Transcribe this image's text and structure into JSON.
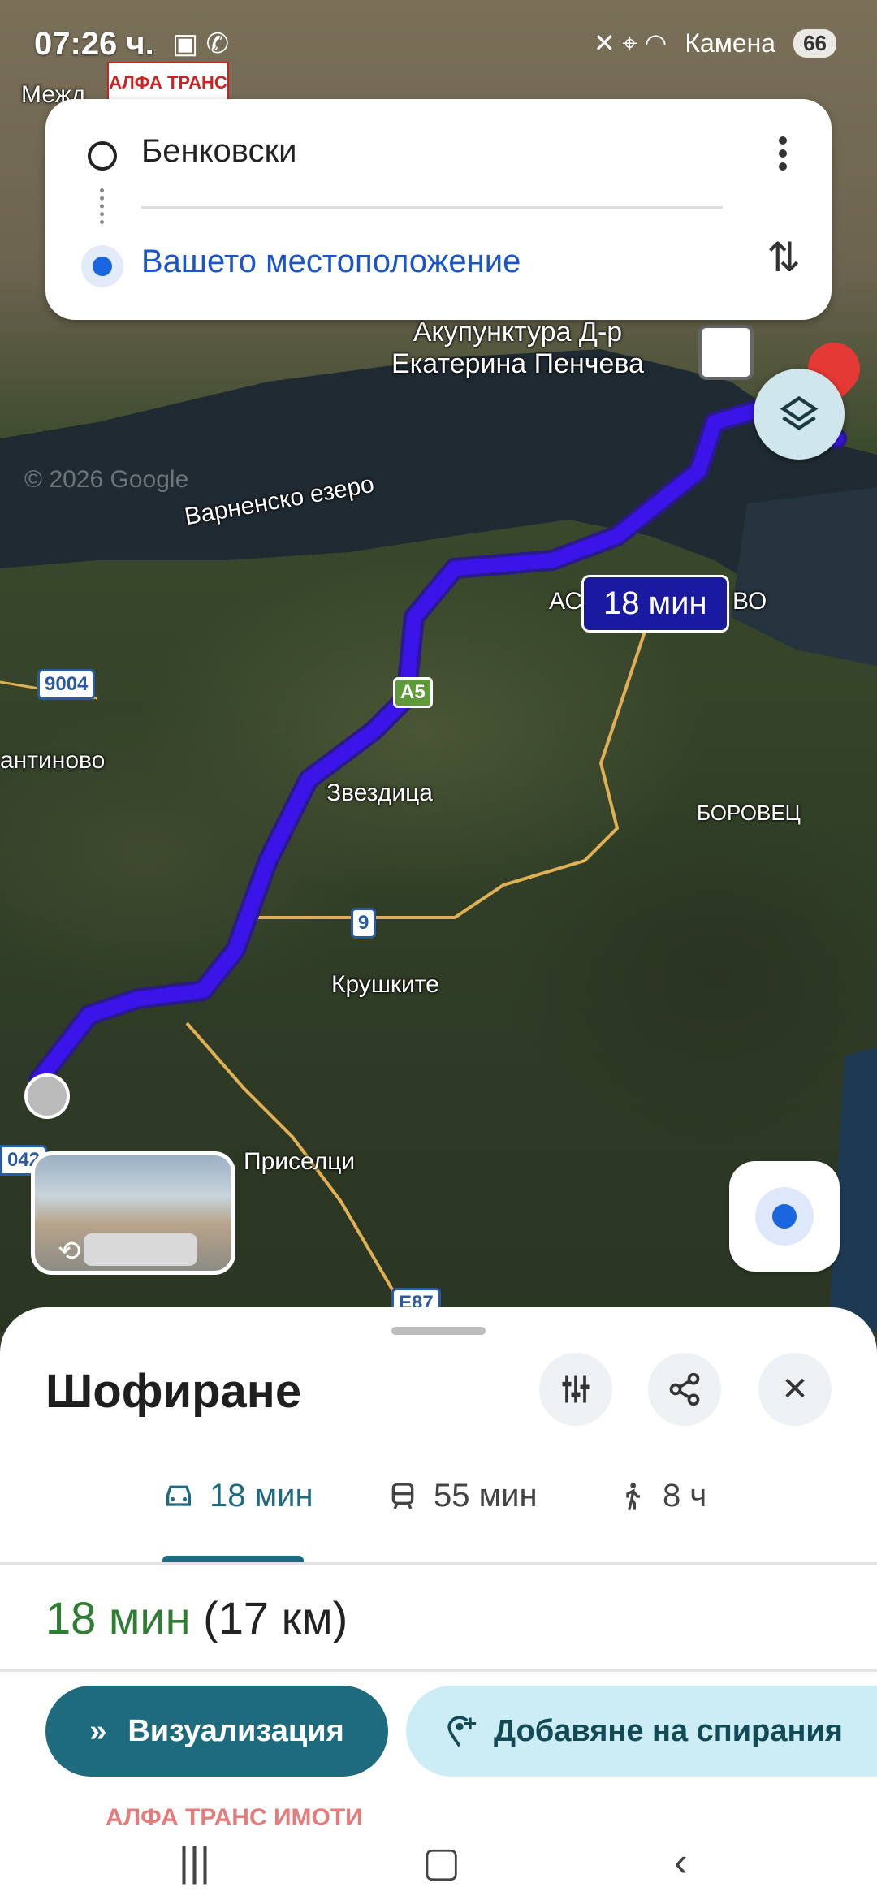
{
  "status_bar": {
    "time": "07:26 ч.",
    "left_icons": "▣ ✆",
    "right_icons": "✕ ⌖ ◠",
    "battery": "66",
    "overlay_text": "Камена"
  },
  "watermark": {
    "top_logo": "АЛФА ТРАНС",
    "bottom_text": "АЛФА ТРАНС ИМОТИ"
  },
  "directions": {
    "origin": "Бенковски",
    "destination": "Вашето местоположение"
  },
  "map": {
    "labels": {
      "poi": "Акупунктура Д-р\nЕкатерина Пенчева",
      "lake": "Варненско езеро",
      "copyright": "© 2026 Google",
      "asparuhovo": "АС",
      "asparuhovo_end": "ВО",
      "konstantinovo": "антиново",
      "zvezditsa": "Звездица",
      "borovets": "БОРОВЕЦ",
      "krushkite": "Крушките",
      "priseltsi": "Приселци",
      "mezhd": "Межд"
    },
    "shields": {
      "r9004": "9004",
      "a5": "A5",
      "r9": "9",
      "e87": "E87",
      "r042": "042"
    },
    "route_time": "18 мин"
  },
  "sheet": {
    "title": "Шофиране",
    "tabs": [
      {
        "label": "18 мин",
        "icon": "car-icon",
        "active": true
      },
      {
        "label": "55 мин",
        "icon": "transit-icon",
        "active": false
      },
      {
        "label": "8 ч",
        "icon": "walk-icon",
        "active": false
      }
    ],
    "summary_duration": "18 мин",
    "summary_distance": "(17 км)",
    "primary_button": "Визуализация",
    "secondary_button": "Добавяне на спирания"
  },
  "colors": {
    "route": "#3a14e8",
    "accent": "#1f6b7e",
    "duration_green": "#2e7d32"
  }
}
